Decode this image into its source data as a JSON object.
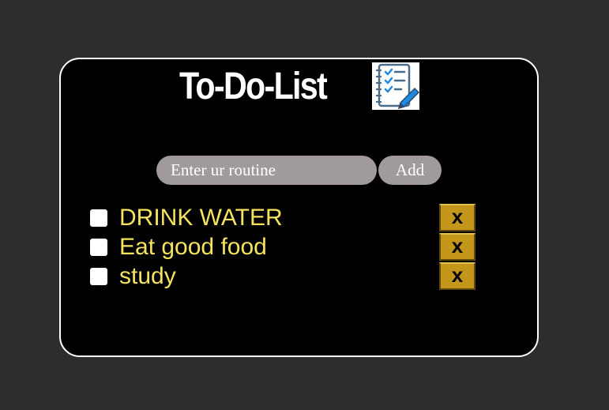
{
  "app": {
    "title": "To-Do-List",
    "logo_icon": "checklist-notebook-icon"
  },
  "input": {
    "placeholder": "Enter ur routine",
    "value": "",
    "add_label": "Add"
  },
  "tasks": [
    {
      "label": "DRINK WATER",
      "checked": false,
      "delete_label": "x"
    },
    {
      "label": "Eat good food",
      "checked": false,
      "delete_label": "x"
    },
    {
      "label": "study",
      "checked": false,
      "delete_label": "x"
    }
  ],
  "colors": {
    "page_background": "#2d2d2d",
    "card_background": "#000000",
    "card_border": "#ffffff",
    "input_background": "#a09a9a",
    "task_text": "#f5e35e",
    "delete_button": "#c4961a"
  }
}
